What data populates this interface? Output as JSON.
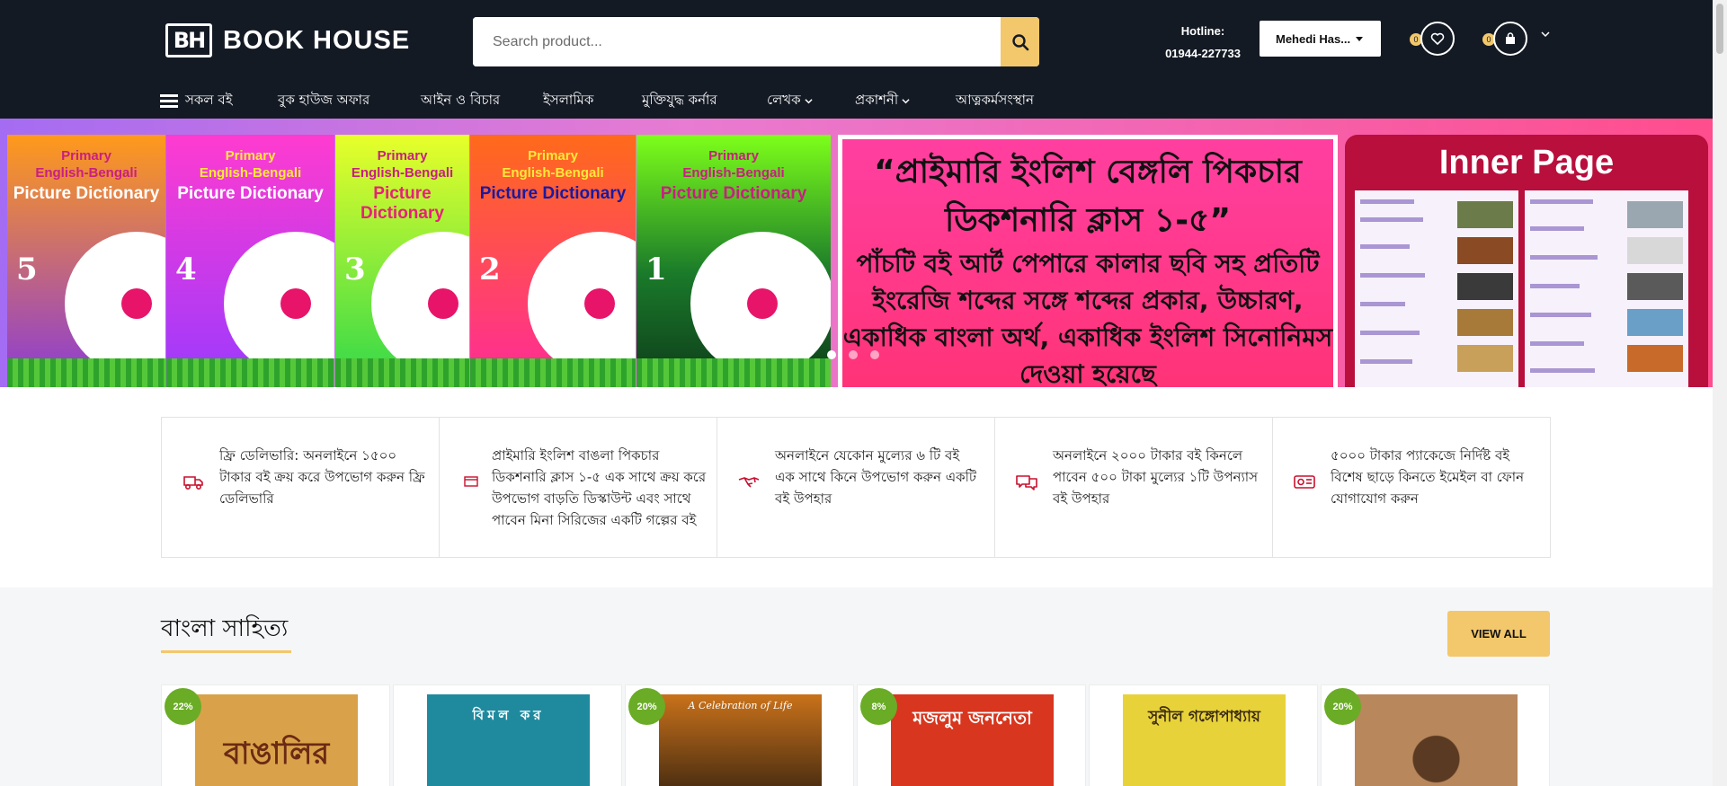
{
  "header": {
    "logo_mark": "BH",
    "logo_text": "BOOK HOUSE",
    "search_placeholder": "Search product...",
    "hotline_label": "Hotline:",
    "hotline_number": "01944-227733",
    "account_name": "Mehedi Has...",
    "wishlist_count": "0",
    "cart_count": "0"
  },
  "nav": {
    "items": [
      "সকল বই",
      "বুক হাউজ অফার",
      "আইন ও বিচার",
      "ইসলামিক",
      "মুক্তিযুদ্ধ কর্নার",
      "লেখক",
      "প্রকাশনী",
      "আত্নকর্মসংস্থান"
    ]
  },
  "banner": {
    "book_series_line1": "Primary",
    "book_series_line2": "English-Bengali",
    "book_series_title": "Picture Dictionary",
    "book_numbers": [
      "5",
      "4",
      "3",
      "2",
      "1"
    ],
    "promo_title": "“প্রাইমারি ইংলিশ বেঙ্গলি পিকচার ডিকশনারি ক্লাস ১-৫”",
    "promo_body": "পাঁচটি বই আর্ট পেপারে কালার ছবি সহ প্রতিটি ইংরেজি শব্দের সঙ্গে শব্দের প্রকার, উচ্চারণ, একাধিক বাংলা অর্থ, একাধিক ইংলিশ সিনোনিমস দেওয়া হয়েছে",
    "inner_title": "Inner Page",
    "slides": 3,
    "active_slide": 0
  },
  "features": [
    {
      "icon": "truck-icon",
      "text": "ফ্রি ডেলিভারি: অনলাইনে ১৫০০ টাকার বই ক্রয় করে উপভোগ করুন ফ্রি ডেলিভারি"
    },
    {
      "icon": "card-icon",
      "text": "প্রাইমারি ইংলিশ বাঙলা পিকচার ডিকশনারি ক্লাস ১-৫ এক সাথে ক্রয় করে উপভোগ বাড়তি ডিস্কাউন্ট এবং সাথে পাবেন মিনা সিরিজের একটি গল্পের বই"
    },
    {
      "icon": "handshake-icon",
      "text": "অনলাইনে যেকোন মুল্যের ৬ টি বই এক সাথে কিনে উপভোগ করুন একটি বই উপহার"
    },
    {
      "icon": "chat-icon",
      "text": "অনলাইনে ২০০০ টাকার বই কিনলে পাবেন ৫০০ টাকা মুল্যের ১টি উপন্যাস বই উপহার"
    },
    {
      "icon": "voucher-icon",
      "text": "৫০০০ টাকার প্যাকেজে নির্দিষ্ট বই বিশেষ ছাড়ে কিনতে ইমেইল বা ফোন যোগাযোগ করুন"
    }
  ],
  "section": {
    "title": "বাংলা সাহিত্য",
    "view_all": "VIEW ALL",
    "products": [
      {
        "discount": "22%",
        "cover_text": "বাঙালির",
        "cover_color": "#d9a24a",
        "text_color": "#6b2a14"
      },
      {
        "discount": "",
        "cover_text": "বিমল কর",
        "cover_color": "#1f8a9e",
        "text_color": "#ffffff"
      },
      {
        "discount": "20%",
        "cover_text": "A Celebration of Life",
        "cover_color": "#c9721a",
        "text_color": "#ffffff"
      },
      {
        "discount": "8%",
        "cover_text": "মজলুম জননেতা",
        "cover_color": "#d8361e",
        "text_color": "#ffffff"
      },
      {
        "discount": "",
        "cover_text": "সুনীল গঙ্গোপাধ্যায়",
        "cover_color": "#e8d23a",
        "text_color": "#3a2a10"
      },
      {
        "discount": "20%",
        "cover_text": "",
        "cover_color": "#b8875c",
        "text_color": "#ffffff"
      }
    ]
  },
  "colors": {
    "header_bg": "#141a24",
    "accent": "#f3c76b",
    "discount_badge": "#6aac26",
    "feature_icon": "#c8102e"
  }
}
